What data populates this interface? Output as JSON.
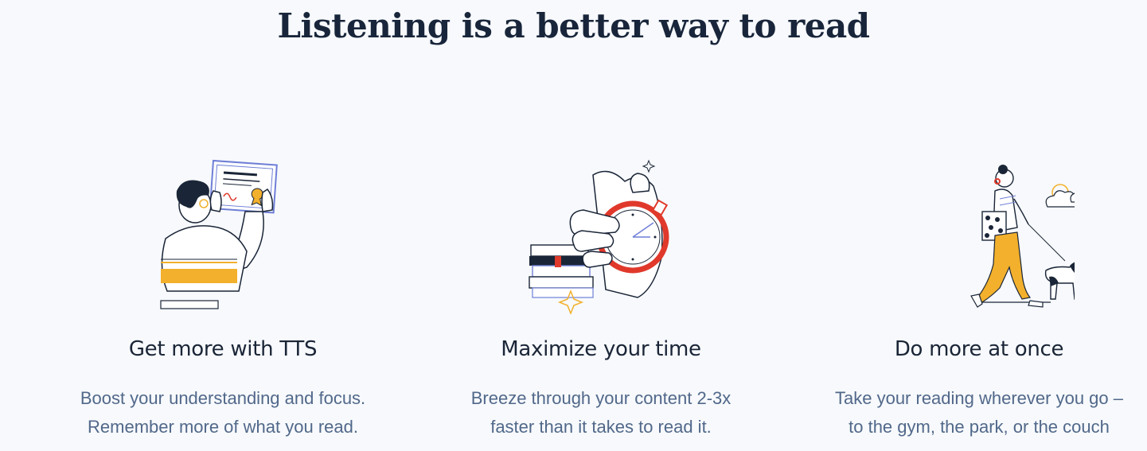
{
  "heading": "Listening is a better way to read",
  "features": [
    {
      "icon": "certificate-illustration",
      "title": "Get more with TTS",
      "desc_line1": "Boost your understanding and focus.",
      "desc_line2": "Remember more of what you read."
    },
    {
      "icon": "stopwatch-illustration",
      "title": "Maximize your time",
      "desc_line1": "Breeze through your content 2-3x",
      "desc_line2": "faster than it takes to read it."
    },
    {
      "icon": "dog-walk-illustration",
      "title": "Do more at once",
      "desc_line1": "Take your reading wherever you go –",
      "desc_line2": "to the gym, the park, or the couch"
    }
  ],
  "colors": {
    "heading": "#18253a",
    "description": "#51688a",
    "accent_yellow": "#f2b02c",
    "accent_red": "#e0392b",
    "accent_blue": "#6f7fd6",
    "background": "#f7f9fc"
  }
}
